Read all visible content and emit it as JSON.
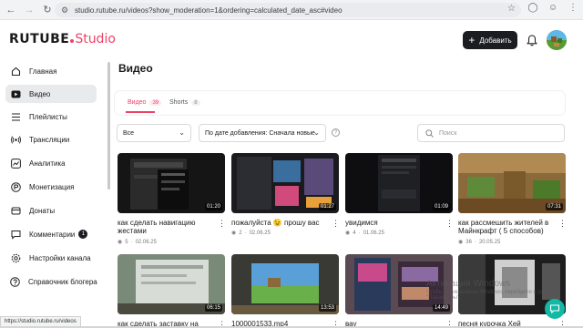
{
  "browser": {
    "url": "studio.rutube.ru/videos?show_moderation=1&ordering=calculated_date_asc#video",
    "status_url": "https://studio.rutube.ru/videos"
  },
  "header": {
    "logo_main": "RUTUBE",
    "logo_studio": "Studio",
    "add_label": "Добавить"
  },
  "sidebar": {
    "items": [
      {
        "label": "Главная",
        "icon": "home-icon"
      },
      {
        "label": "Видео",
        "icon": "video-icon",
        "active": true
      },
      {
        "label": "Плейлисты",
        "icon": "playlist-icon"
      },
      {
        "label": "Трансляции",
        "icon": "broadcast-icon"
      },
      {
        "label": "Аналитика",
        "icon": "analytics-icon"
      },
      {
        "label": "Монетизация",
        "icon": "monetization-icon"
      },
      {
        "label": "Донаты",
        "icon": "donations-icon"
      },
      {
        "label": "Комментарии",
        "icon": "comments-icon",
        "badge": "1"
      },
      {
        "label": "Настройки канала",
        "icon": "settings-icon"
      },
      {
        "label": "Справочник блогера",
        "icon": "help-book-icon"
      }
    ]
  },
  "main": {
    "title": "Видео",
    "tabs": [
      {
        "label": "Видео",
        "count": "39"
      },
      {
        "label": "Shorts",
        "count": "8"
      }
    ],
    "filter_all": "Все",
    "filter_sort": "По дате добавления: Сначала новые",
    "search_placeholder": "Поиск"
  },
  "videos": [
    {
      "title": "как сделать навигацию жестами",
      "duration": "01:20",
      "views": "5",
      "date": "02.06.25"
    },
    {
      "title": "пожалуйста 😉 прошу вас",
      "duration": "01:27",
      "views": "2",
      "date": "02.06.25"
    },
    {
      "title": "увидимся",
      "duration": "01:09",
      "views": "4",
      "date": "01.06.25"
    },
    {
      "title": "как рассмешить жителей в Майнкрафт ( 5 способов)",
      "duration": "07:31",
      "views": "36",
      "date": "20.05.25"
    },
    {
      "title": "как сделать заставку на",
      "duration": "06:15",
      "views": "",
      "date": ""
    },
    {
      "title": "1000001533.mp4",
      "duration": "13:53",
      "views": "",
      "date": ""
    },
    {
      "title": "вау",
      "duration": "14:49",
      "views": "",
      "date": ""
    },
    {
      "title": "песня курочка Хей",
      "duration": "",
      "views": "",
      "date": ""
    }
  ],
  "watermark": {
    "title": "Активация Windows",
    "sub": "Чтобы активировать Windows, перейдите в раздел \"Параметры\"."
  },
  "colors": {
    "accent": "#ee4266",
    "dark": "#1c1d21",
    "fab": "#13b9a4"
  }
}
